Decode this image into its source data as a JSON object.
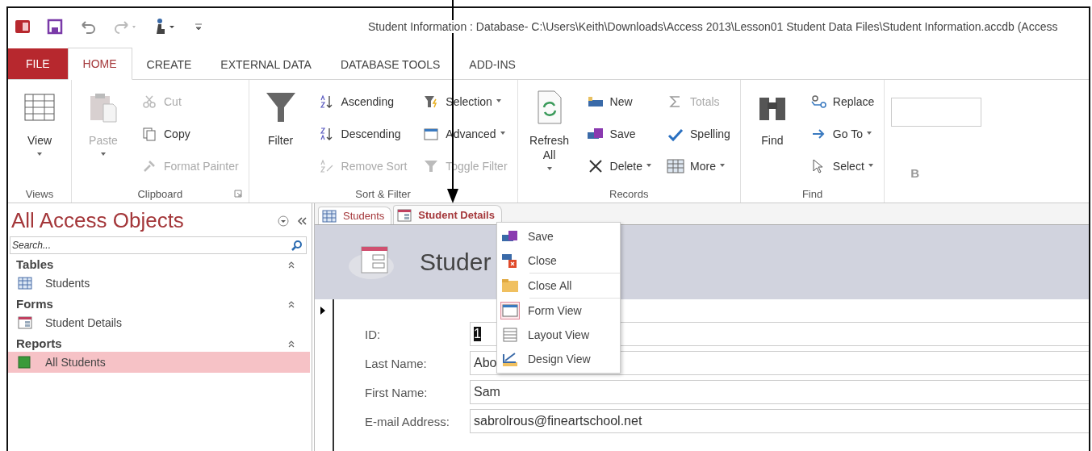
{
  "window": {
    "title": "Student Information : Database- C:\\Users\\Keith\\Downloads\\Access 2013\\Lesson01 Student Data Files\\Student Information.accdb (Access"
  },
  "ribbon_tabs": [
    {
      "label": "FILE",
      "kind": "file",
      "selected": false
    },
    {
      "label": "HOME",
      "kind": "tab",
      "selected": true
    },
    {
      "label": "CREATE",
      "kind": "tab",
      "selected": false
    },
    {
      "label": "EXTERNAL DATA",
      "kind": "tab",
      "selected": false
    },
    {
      "label": "DATABASE TOOLS",
      "kind": "tab",
      "selected": false
    },
    {
      "label": "ADD-INS",
      "kind": "tab",
      "selected": false
    }
  ],
  "ribbon_groups": [
    {
      "label": "Views",
      "kind": "buttons",
      "buttons": [
        {
          "kind": "large",
          "label": "View",
          "dropdown": true,
          "disabled": false
        }
      ]
    },
    {
      "label": "Clipboard",
      "kind": "buttons",
      "has_launcher": true,
      "buttons": [
        {
          "kind": "large",
          "label": "Paste",
          "dropdown": true,
          "disabled": true
        },
        {
          "kind": "small",
          "label": "Cut",
          "disabled": true
        },
        {
          "kind": "small",
          "label": "Copy",
          "disabled": false
        },
        {
          "kind": "small",
          "label": "Format Painter",
          "disabled": true
        }
      ]
    },
    {
      "label": "Sort & Filter",
      "kind": "buttons",
      "buttons": [
        {
          "kind": "large",
          "label": "Filter",
          "disabled": false
        },
        {
          "kind": "small",
          "label": "Ascending",
          "disabled": false
        },
        {
          "kind": "small",
          "label": "Descending",
          "disabled": false
        },
        {
          "kind": "small",
          "label": "Remove Sort",
          "disabled": true
        },
        {
          "kind": "small",
          "label": "Selection",
          "dropdown": true,
          "disabled": false
        },
        {
          "kind": "small",
          "label": "Advanced",
          "dropdown": true,
          "disabled": false
        },
        {
          "kind": "small",
          "label": "Toggle Filter",
          "disabled": true
        }
      ]
    },
    {
      "label": "Records",
      "kind": "buttons",
      "buttons": [
        {
          "kind": "large",
          "label": "Refresh All",
          "dropdown": true,
          "disabled": false
        },
        {
          "kind": "small",
          "label": "New",
          "disabled": false
        },
        {
          "kind": "small",
          "label": "Save",
          "disabled": false
        },
        {
          "kind": "small",
          "label": "Delete",
          "dropdown": true,
          "disabled": false
        },
        {
          "kind": "small",
          "label": "Totals",
          "disabled": true
        },
        {
          "kind": "small",
          "label": "Spelling",
          "disabled": false
        },
        {
          "kind": "small",
          "label": "More",
          "dropdown": true,
          "disabled": false
        }
      ]
    },
    {
      "label": "Find",
      "kind": "buttons",
      "buttons": [
        {
          "kind": "large",
          "label": "Find",
          "disabled": false
        },
        {
          "kind": "small",
          "label": "Replace",
          "disabled": false
        },
        {
          "kind": "small",
          "label": "Go To",
          "dropdown": true,
          "disabled": false
        },
        {
          "kind": "small",
          "label": "Select",
          "dropdown": true,
          "disabled": false
        }
      ]
    },
    {
      "kind": "format",
      "bold_button": "B"
    }
  ],
  "navigation": {
    "title": "All Access Objects",
    "search": {
      "placeholder": "Search..."
    },
    "groups": [
      {
        "label": "Tables",
        "items": [
          {
            "label": "Students",
            "selected": false
          }
        ]
      },
      {
        "label": "Forms",
        "items": [
          {
            "label": "Student Details",
            "selected": false
          }
        ]
      },
      {
        "label": "Reports",
        "items": [
          {
            "label": "All Students",
            "selected": true
          }
        ]
      }
    ]
  },
  "document_tabs": [
    {
      "label": "Students",
      "selected": false
    },
    {
      "label": "Student Details",
      "selected": true
    }
  ],
  "form": {
    "title": "Studer",
    "fields": [
      {
        "label": "ID:",
        "value": "1",
        "selected": true
      },
      {
        "label": "Last Name:",
        "value": "Abo",
        "selected": false
      },
      {
        "label": "First Name:",
        "value": "Sam",
        "selected": false
      },
      {
        "label": "E-mail Address:",
        "value": "sabrolrous@fineartschool.net",
        "selected": false
      }
    ]
  },
  "context_menu": [
    {
      "items": [
        {
          "label": "Save",
          "selected": false
        },
        {
          "label": "Close",
          "selected": false
        }
      ]
    },
    {
      "items": [
        {
          "label": "Close All",
          "selected": false
        }
      ]
    },
    {
      "items": [
        {
          "label": "Form View",
          "selected": true
        },
        {
          "label": "Layout View",
          "selected": false
        },
        {
          "label": "Design View",
          "selected": false
        }
      ]
    }
  ]
}
